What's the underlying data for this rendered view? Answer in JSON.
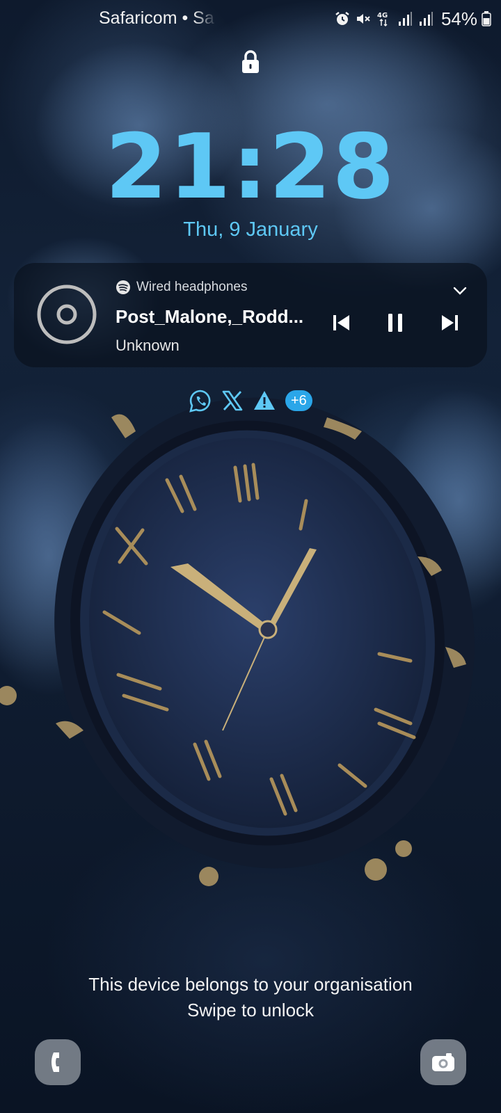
{
  "status_bar": {
    "carrier": "Safaricom • Sa",
    "battery": "54%",
    "icons": [
      "alarm-icon",
      "mute-icon",
      "4g-icon",
      "signal-icon",
      "signal-icon",
      "battery-icon"
    ]
  },
  "lock_screen": {
    "time": "21:28",
    "date": "Thu, 9 January",
    "accent_color": "#5ec8f5"
  },
  "media": {
    "source": "Wired headphones",
    "source_icon": "spotify-icon",
    "title": "Post_Malone,_Rodd...",
    "artist": "Unknown",
    "controls": [
      "previous-icon",
      "pause-icon",
      "next-icon"
    ]
  },
  "notifications": {
    "icons": [
      "whatsapp-icon",
      "x-icon",
      "warning-icon"
    ],
    "more_count": "+6",
    "badge_color": "#2aa6e9"
  },
  "footer": {
    "org_message": "This device belongs to your organisation",
    "unlock_hint": "Swipe to unlock"
  },
  "shortcuts": {
    "left": "phone-icon",
    "right": "camera-icon"
  }
}
